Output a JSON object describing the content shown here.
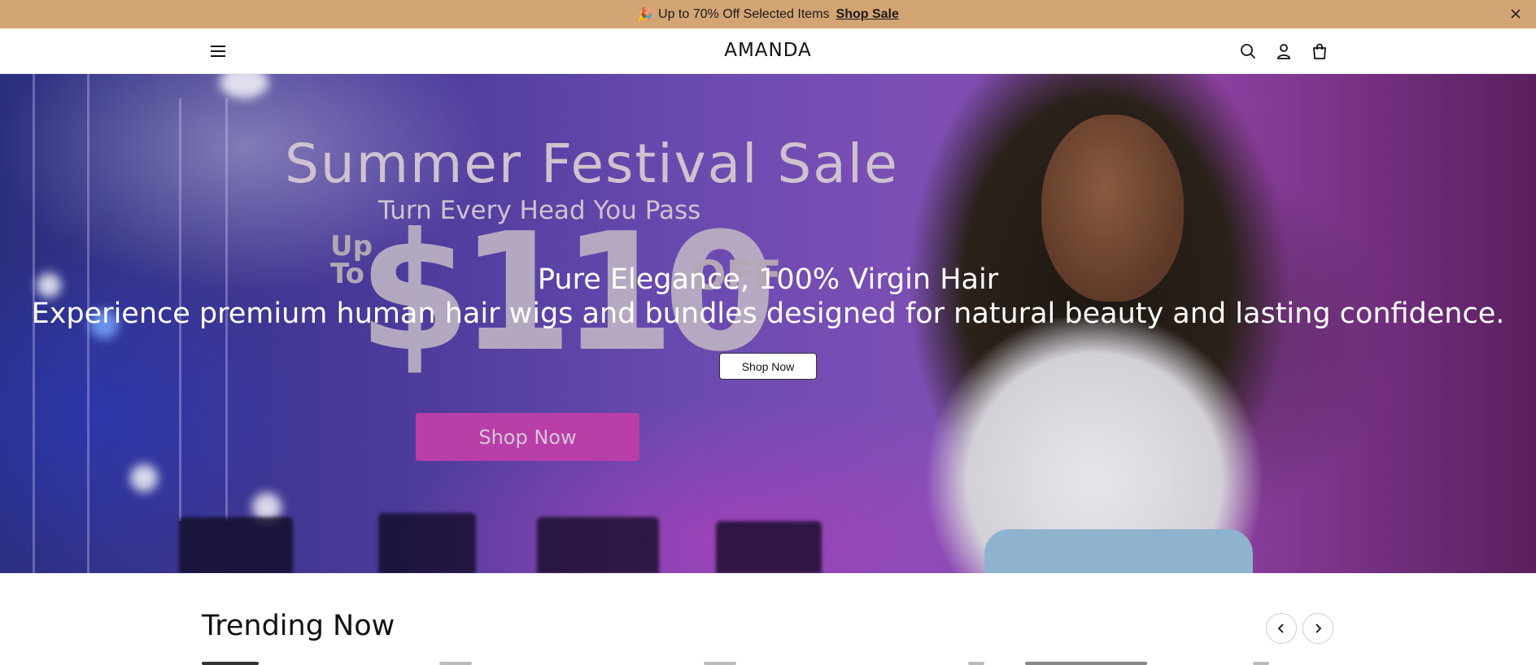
{
  "announcement": {
    "icon": "party-popper-icon",
    "text": "Up to 70% Off Selected Items",
    "link_label": "Shop Sale"
  },
  "header": {
    "logo": "AMANDA"
  },
  "hero": {
    "poster": {
      "title": "Summer Festival Sale",
      "subtitle": "Turn Every Head You Pass",
      "up_to": "Up To",
      "amount": "$110",
      "off": "OFF",
      "shop_label": "Shop Now"
    },
    "heading": "Pure Elegance, 100% Virgin Hair",
    "text": "Experience premium human hair wigs and bundles designed for natural beauty and lasting confidence.",
    "button_label": "Shop Now"
  },
  "trending": {
    "title": "Trending Now"
  },
  "colors": {
    "announcement_bg": "#d4a574",
    "poster_button": "#b93ea8"
  }
}
